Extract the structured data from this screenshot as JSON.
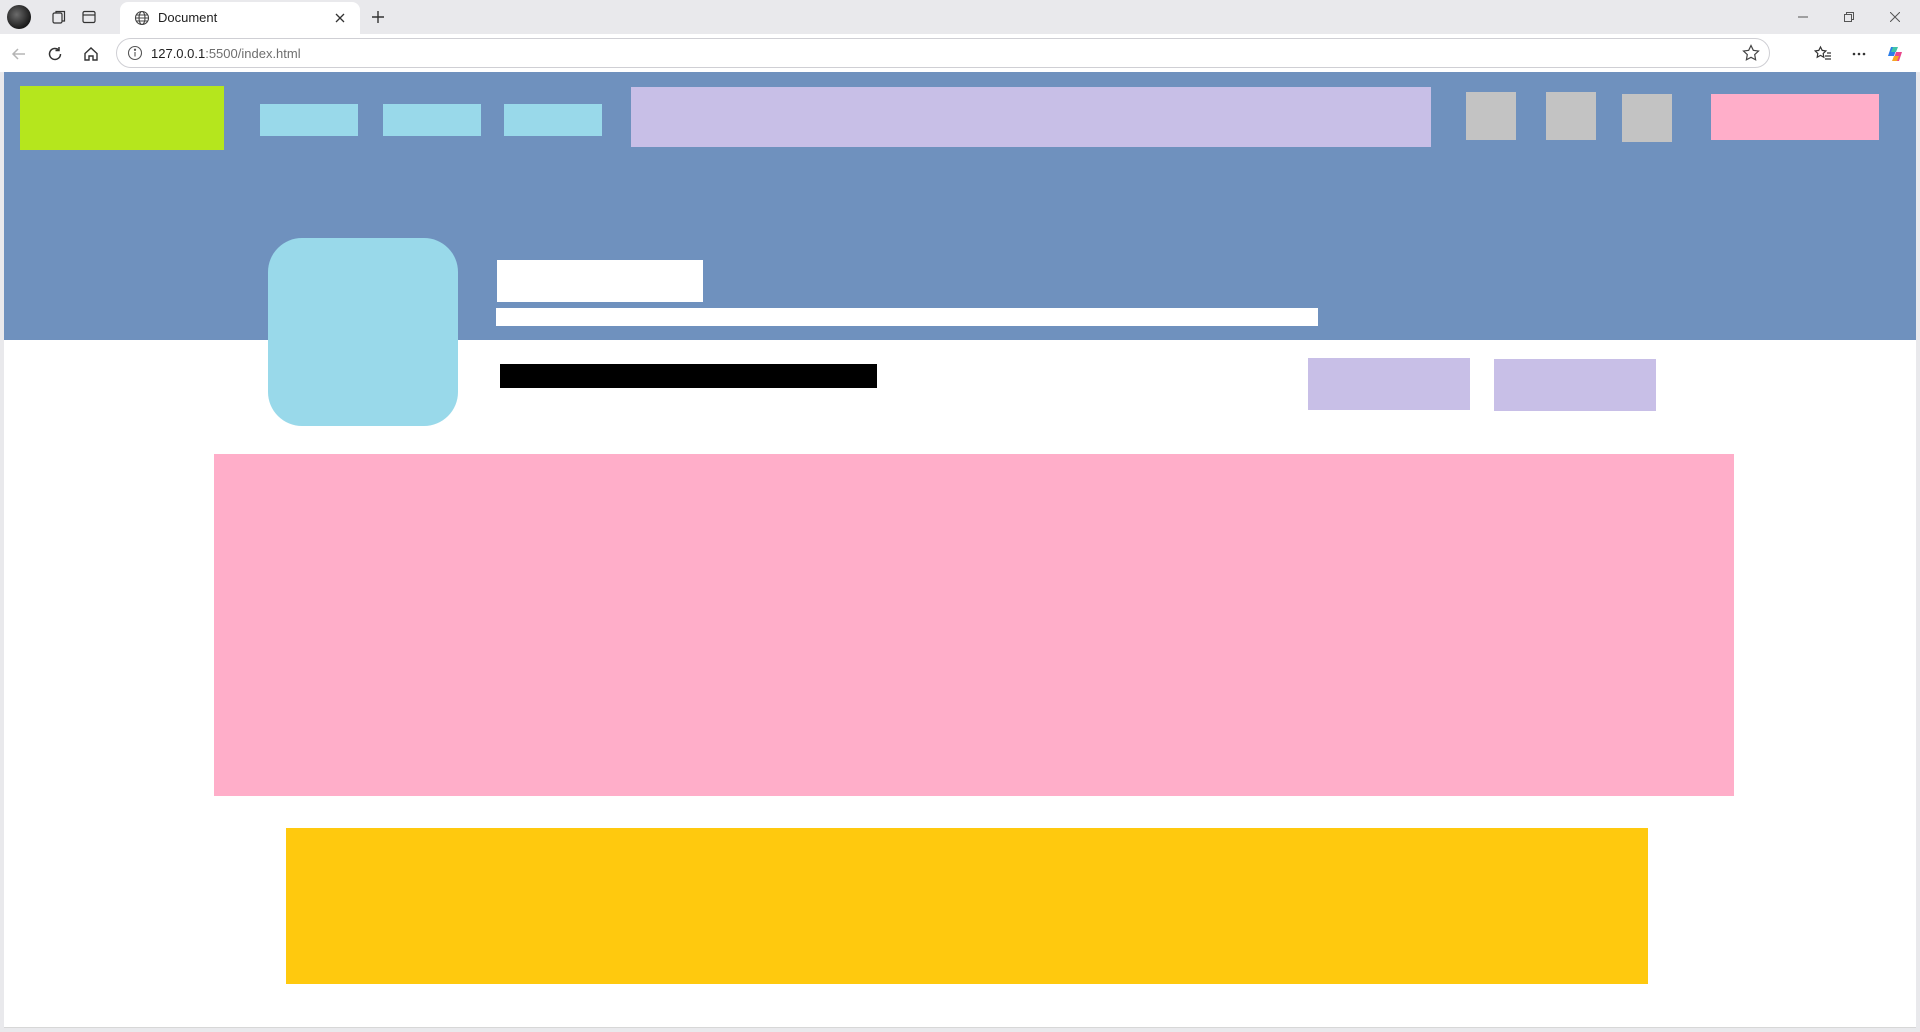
{
  "browser": {
    "tab_title": "Document",
    "url_host": "127.0.0.1",
    "url_rest": ":5500/index.html"
  },
  "page": {
    "colors": {
      "hero": "#6f91be",
      "logo": "#b5e61d",
      "nav": "#99d9ea",
      "search": "#c8bfe7",
      "utility": "#c3c3c3",
      "cta": "#ffaec9",
      "avatar": "#99d9ea",
      "panel_pink": "#ffaec9",
      "panel_yellow": "#ffc90e"
    }
  }
}
